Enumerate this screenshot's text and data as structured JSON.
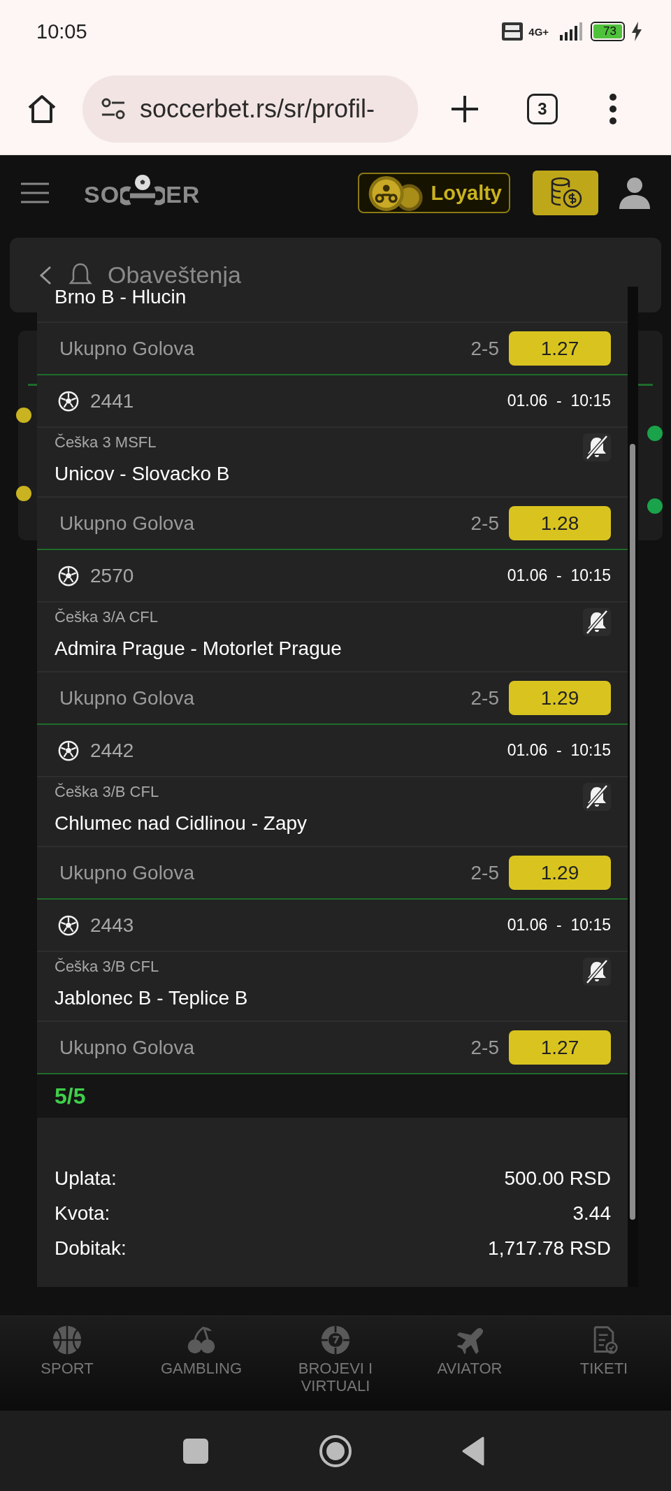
{
  "status_bar": {
    "time": "10:05",
    "network": "4G+",
    "battery": "73"
  },
  "browser": {
    "url": "soccerbet.rs/sr/profil-",
    "tab_count": "3"
  },
  "header": {
    "logo_left": "SO",
    "logo_right": "ER",
    "loyalty": "Loyalty"
  },
  "page_title": "Obaveštenja",
  "ticket": {
    "top_match": "Brno B - Hlucin",
    "top_market": {
      "market": "Ukupno Golova",
      "pick": "2-5",
      "odds": "1.27"
    },
    "matches": [
      {
        "code": "2441",
        "datetime": "01.06  -  10:15",
        "league": "Češka 3 MSFL",
        "name": "Unicov - Slovacko B",
        "notifications_off": true,
        "market": "Ukupno Golova",
        "pick": "2-5",
        "odds": "1.28"
      },
      {
        "code": "2570",
        "datetime": "01.06  -  10:15",
        "league": "Češka 3/A CFL",
        "name": "Admira Prague - Motorlet Prague",
        "notifications_off": true,
        "market": "Ukupno Golova",
        "pick": "2-5",
        "odds": "1.29"
      },
      {
        "code": "2442",
        "datetime": "01.06  -  10:15",
        "league": "Češka 3/B CFL",
        "name": "Chlumec nad Cidlinou - Zapy",
        "notifications_off": true,
        "market": "Ukupno Golova",
        "pick": "2-5",
        "odds": "1.29"
      },
      {
        "code": "2443",
        "datetime": "01.06  -  10:15",
        "league": "Češka 3/B CFL",
        "name": "Jablonec B - Teplice B",
        "notifications_off": true,
        "market": "Ukupno Golova",
        "pick": "2-5",
        "odds": "1.27"
      }
    ],
    "count": "5/5",
    "summary": [
      {
        "label": "Uplata:",
        "value": "500.00 RSD"
      },
      {
        "label": "Kvota:",
        "value": "3.44"
      },
      {
        "label": "Dobitak:",
        "value": "1,717.78 RSD"
      }
    ]
  },
  "bottom_nav": [
    {
      "label": "SPORT",
      "kind": "ball"
    },
    {
      "label": "GAMBLING",
      "kind": "cherry"
    },
    {
      "label": "BROJEVI I VIRTUALI",
      "kind": "lotto"
    },
    {
      "label": "AVIATOR",
      "kind": "plane"
    },
    {
      "label": "TIKETI",
      "kind": "ticket"
    }
  ]
}
